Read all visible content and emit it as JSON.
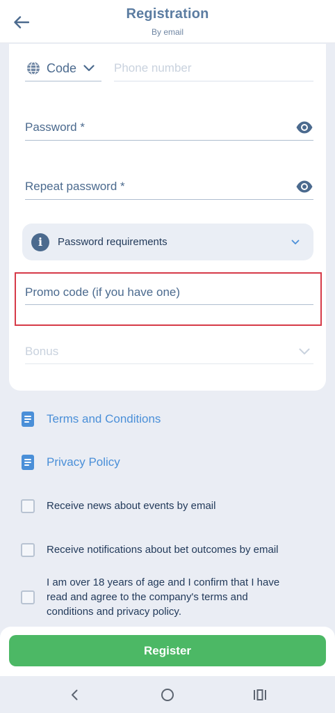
{
  "header": {
    "title": "Registration",
    "subtitle": "By email",
    "back_icon": "arrow-left-icon"
  },
  "form": {
    "code_label": "Code",
    "phone_placeholder": "Phone number",
    "password_label": "Password *",
    "repeat_password_label": "Repeat password *",
    "password_requirements_label": "Password requirements",
    "promo_label": "Promo code (if you have one)",
    "bonus_placeholder": "Bonus"
  },
  "links": {
    "terms": "Terms and Conditions",
    "privacy": "Privacy Policy"
  },
  "checkboxes": {
    "news": "Receive news about events by email",
    "notifications": "Receive notifications about bet outcomes by email",
    "age": "I am over 18 years of age and I confirm that I have read and agree to the company's terms and conditions and privacy policy."
  },
  "actions": {
    "register_label": "Register"
  },
  "colors": {
    "accent": "#4cb865",
    "link": "#4a8fd8",
    "highlight": "#d63a48",
    "primary_text": "#4b6a8e"
  }
}
